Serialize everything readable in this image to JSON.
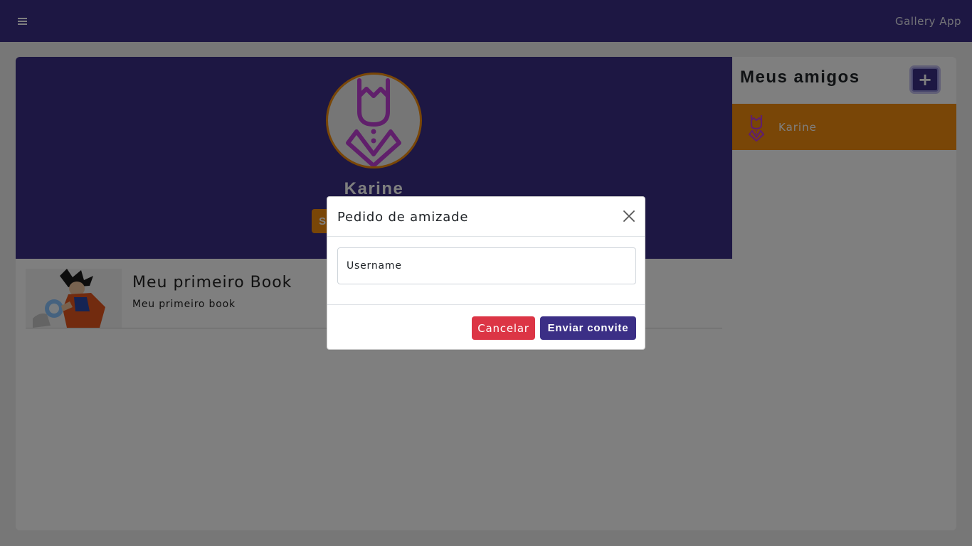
{
  "navbar": {
    "menu_icon": "hamburger-menu-icon",
    "brand": "Gallery App"
  },
  "profile": {
    "avatar_icon": "king-avatar-icon",
    "name": "Karine",
    "button_label": "S"
  },
  "books": [
    {
      "thumbnail": "goku-image",
      "title": "Meu primeiro Book",
      "description": "Meu primeiro book"
    }
  ],
  "friends": {
    "title": "Meus amigos",
    "add_label": "+",
    "items": [
      {
        "name": "Karine",
        "avatar_icon": "king-avatar-icon"
      }
    ]
  },
  "modal": {
    "title": "Pedido de amizade",
    "close_icon": "close-icon",
    "username_placeholder": "Username",
    "cancel_label": "Cancelar",
    "submit_label": "Enviar convite"
  },
  "colors": {
    "primary": "#3b2f86",
    "accent": "#f28c0f",
    "danger": "#dc3545",
    "avatar_glyph": "#c13ed6"
  }
}
